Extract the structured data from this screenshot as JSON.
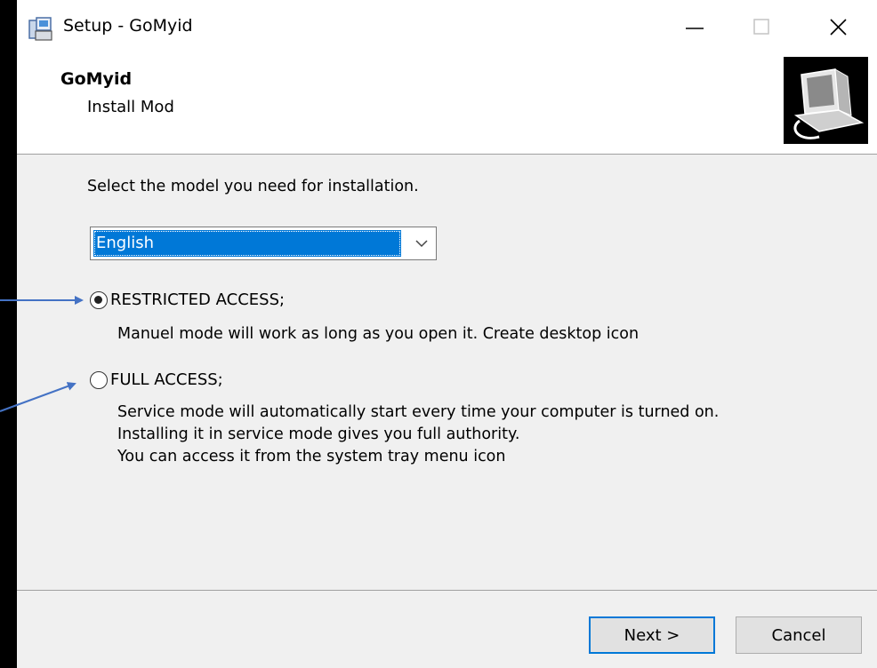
{
  "window": {
    "title": "Setup - GoMyid"
  },
  "header": {
    "title": "GoMyid",
    "subtitle": "Install Mod"
  },
  "body": {
    "prompt": "Select the model you need for installation.",
    "language_select": {
      "value": "English"
    },
    "options": [
      {
        "label": "RESTRICTED ACCESS;",
        "checked": true,
        "description": [
          "Manuel mode will work as long as you open it. Create desktop icon"
        ]
      },
      {
        "label": "FULL ACCESS;",
        "checked": false,
        "description": [
          "Service mode will automatically start every time your computer is turned on.",
          "Installing it in service mode gives you full authority.",
          "You can access it from the system tray menu icon"
        ]
      }
    ]
  },
  "footer": {
    "next_label": "Next >",
    "cancel_label": "Cancel"
  },
  "colors": {
    "accent": "#0078d7",
    "annotation_arrow": "#4472c4",
    "window_bg": "#f0f0f0"
  }
}
